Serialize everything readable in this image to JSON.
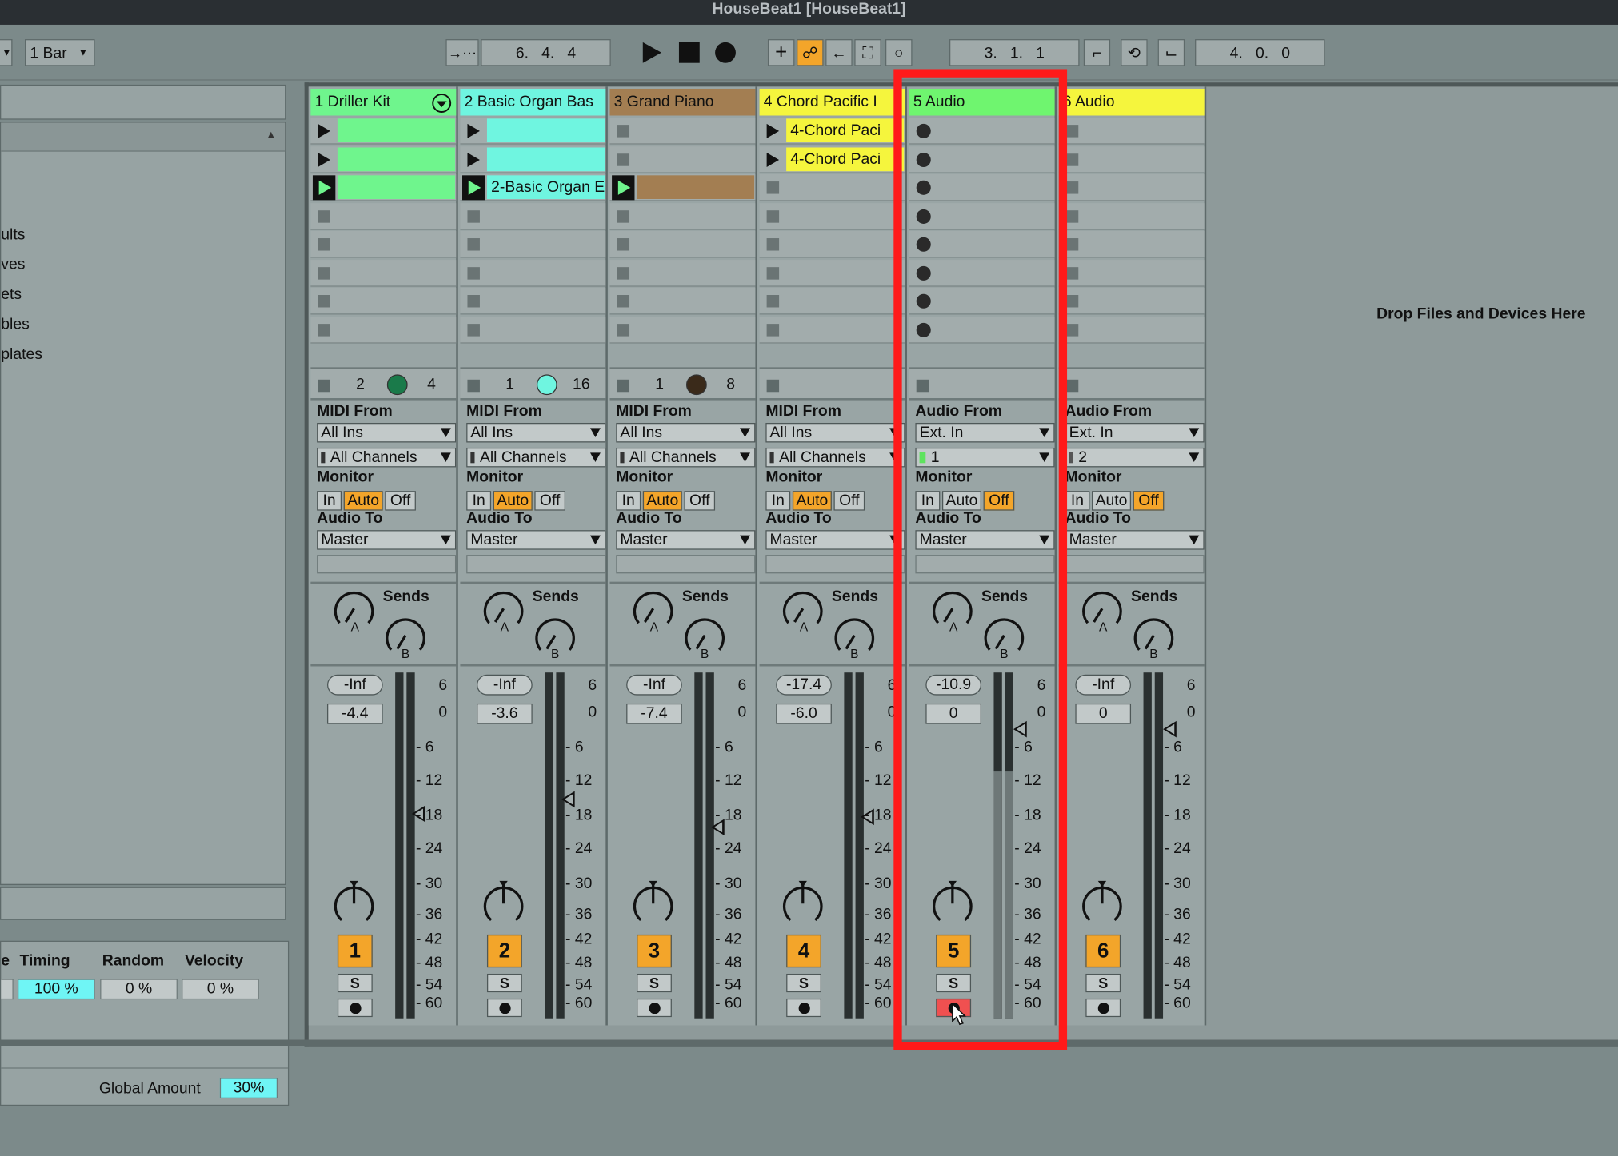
{
  "window": {
    "title": "HouseBeat1  [HouseBeat1]"
  },
  "toolbar": {
    "quantize": "1 Bar",
    "song_position": "6.   4.   4",
    "loop_start": "3.   1.   1",
    "loop_length": "4.   0.   0"
  },
  "browser": {
    "items": [
      "ults",
      "ves",
      "ets",
      "bles",
      "plates"
    ]
  },
  "groove": {
    "headers": [
      "e",
      "Timing",
      "Random",
      "Velocity"
    ],
    "values": [
      "100 %",
      "0 %",
      "0 %"
    ],
    "global_label": "Global Amount",
    "global_value": "30%"
  },
  "drop_text": "Drop Files and Devices Here",
  "tracks": [
    {
      "name": "1 Driller Kit",
      "header_color": "#6ff58d",
      "clip_color": "#6ff58d",
      "slots": [
        "play",
        "play",
        "playing",
        "stop",
        "stop",
        "stop",
        "stop",
        "stop"
      ],
      "clip_names": [
        "",
        "",
        "",
        "",
        "",
        "",
        "",
        ""
      ],
      "stop_row": [
        "2",
        "4"
      ],
      "knob_color": "#1a7a4a",
      "io_type": "MIDI",
      "from_label": "MIDI From",
      "from": "All Ins",
      "channel": "All Channels",
      "monitor_label": "Monitor",
      "monitor": [
        "In",
        "Auto",
        "Off"
      ],
      "monitor_on": 1,
      "to_label": "Audio To",
      "to": "Master",
      "sends_label": "Sends",
      "send_a": "A",
      "send_b": "B",
      "vol_peak": "-Inf",
      "vol": "-4.4",
      "fader_level": 0.59,
      "num": "1",
      "solo": "S",
      "armed": false
    },
    {
      "name": "2 Basic Organ Bas",
      "header_color": "#6ff5e0",
      "clip_color": "#6ff5e0",
      "slots": [
        "play",
        "play",
        "playing",
        "stop",
        "stop",
        "stop",
        "stop",
        "stop"
      ],
      "clip_names": [
        "",
        "",
        "2-Basic Organ E",
        "",
        "",
        "",
        "",
        ""
      ],
      "stop_row": [
        "1",
        "16"
      ],
      "knob_color": "#6ff5e0",
      "io_type": "MIDI",
      "from_label": "MIDI From",
      "from": "All Ins",
      "channel": "All Channels",
      "monitor_label": "Monitor",
      "monitor": [
        "In",
        "Auto",
        "Off"
      ],
      "monitor_on": 1,
      "to_label": "Audio To",
      "to": "Master",
      "sends_label": "Sends",
      "send_a": "A",
      "send_b": "B",
      "vol_peak": "-Inf",
      "vol": "-3.6",
      "fader_level": 0.63,
      "num": "2",
      "solo": "S",
      "armed": false
    },
    {
      "name": "3 Grand Piano",
      "header_color": "#a37e52",
      "clip_color": "#a37e52",
      "slots": [
        "stop",
        "stop",
        "playing",
        "stop",
        "stop",
        "stop",
        "stop",
        "stop"
      ],
      "clip_names": [
        "",
        "",
        "",
        "",
        "",
        "",
        "",
        ""
      ],
      "stop_row": [
        "1",
        "8"
      ],
      "knob_color": "#3a2a1a",
      "io_type": "MIDI",
      "from_label": "MIDI From",
      "from": "All Ins",
      "channel": "All Channels",
      "monitor_label": "Monitor",
      "monitor": [
        "In",
        "Auto",
        "Off"
      ],
      "monitor_on": 1,
      "to_label": "Audio To",
      "to": "Master",
      "sends_label": "Sends",
      "send_a": "A",
      "send_b": "B",
      "vol_peak": "-Inf",
      "vol": "-7.4",
      "fader_level": 0.55,
      "num": "3",
      "solo": "S",
      "armed": false
    },
    {
      "name": "4 Chord Pacific I",
      "header_color": "#f5f53d",
      "clip_color": "#f5f53d",
      "slots": [
        "play",
        "play",
        "stop",
        "stop",
        "stop",
        "stop",
        "stop",
        "stop"
      ],
      "clip_names": [
        "4-Chord Paci",
        "4-Chord Paci",
        "",
        "",
        "",
        "",
        "",
        ""
      ],
      "stop_row": [
        "",
        ""
      ],
      "knob_color": "",
      "io_type": "MIDI",
      "from_label": "MIDI From",
      "from": "All Ins",
      "channel": "All Channels",
      "monitor_label": "Monitor",
      "monitor": [
        "In",
        "Auto",
        "Off"
      ],
      "monitor_on": 1,
      "to_label": "Audio To",
      "to": "Master",
      "sends_label": "Sends",
      "send_a": "A",
      "send_b": "B",
      "vol_peak": "-17.4",
      "vol": "-6.0",
      "fader_level": 0.58,
      "num": "4",
      "solo": "S",
      "armed": false
    },
    {
      "name": "5 Audio",
      "header_color": "#6ff56f",
      "clip_color": "",
      "slots": [
        "rec",
        "rec",
        "rec",
        "rec",
        "rec",
        "rec",
        "rec",
        "rec"
      ],
      "clip_names": [
        "",
        "",
        "",
        "",
        "",
        "",
        "",
        ""
      ],
      "stop_row": [
        "",
        ""
      ],
      "knob_color": "",
      "io_type": "Audio",
      "from_label": "Audio From",
      "from": "Ext. In",
      "channel": "1",
      "monitor_label": "Monitor",
      "monitor": [
        "In",
        "Auto",
        "Off"
      ],
      "monitor_on": 2,
      "to_label": "Audio To",
      "to": "Master",
      "sends_label": "Sends",
      "send_a": "A",
      "send_b": "B",
      "vol_peak": "-10.9",
      "vol": "0",
      "fader_level": 0.83,
      "num": "5",
      "solo": "S",
      "armed": true
    },
    {
      "name": "6 Audio",
      "header_color": "#f5f53d",
      "clip_color": "",
      "slots": [
        "stop",
        "stop",
        "stop",
        "stop",
        "stop",
        "stop",
        "stop",
        "stop"
      ],
      "clip_names": [
        "",
        "",
        "",
        "",
        "",
        "",
        "",
        ""
      ],
      "stop_row": [
        "",
        ""
      ],
      "knob_color": "",
      "io_type": "Audio",
      "from_label": "Audio From",
      "from": "Ext. In",
      "channel": "2",
      "monitor_label": "Monitor",
      "monitor": [
        "In",
        "Auto",
        "Off"
      ],
      "monitor_on": 2,
      "to_label": "Audio To",
      "to": "Master",
      "sends_label": "Sends",
      "send_a": "A",
      "send_b": "B",
      "vol_peak": "-Inf",
      "vol": "0",
      "fader_level": 0.83,
      "num": "6",
      "solo": "S",
      "armed": false
    }
  ],
  "meter_ticks": [
    "6",
    "0",
    "6",
    "12",
    "18",
    "24",
    "30",
    "36",
    "42",
    "48",
    "54",
    "60"
  ]
}
